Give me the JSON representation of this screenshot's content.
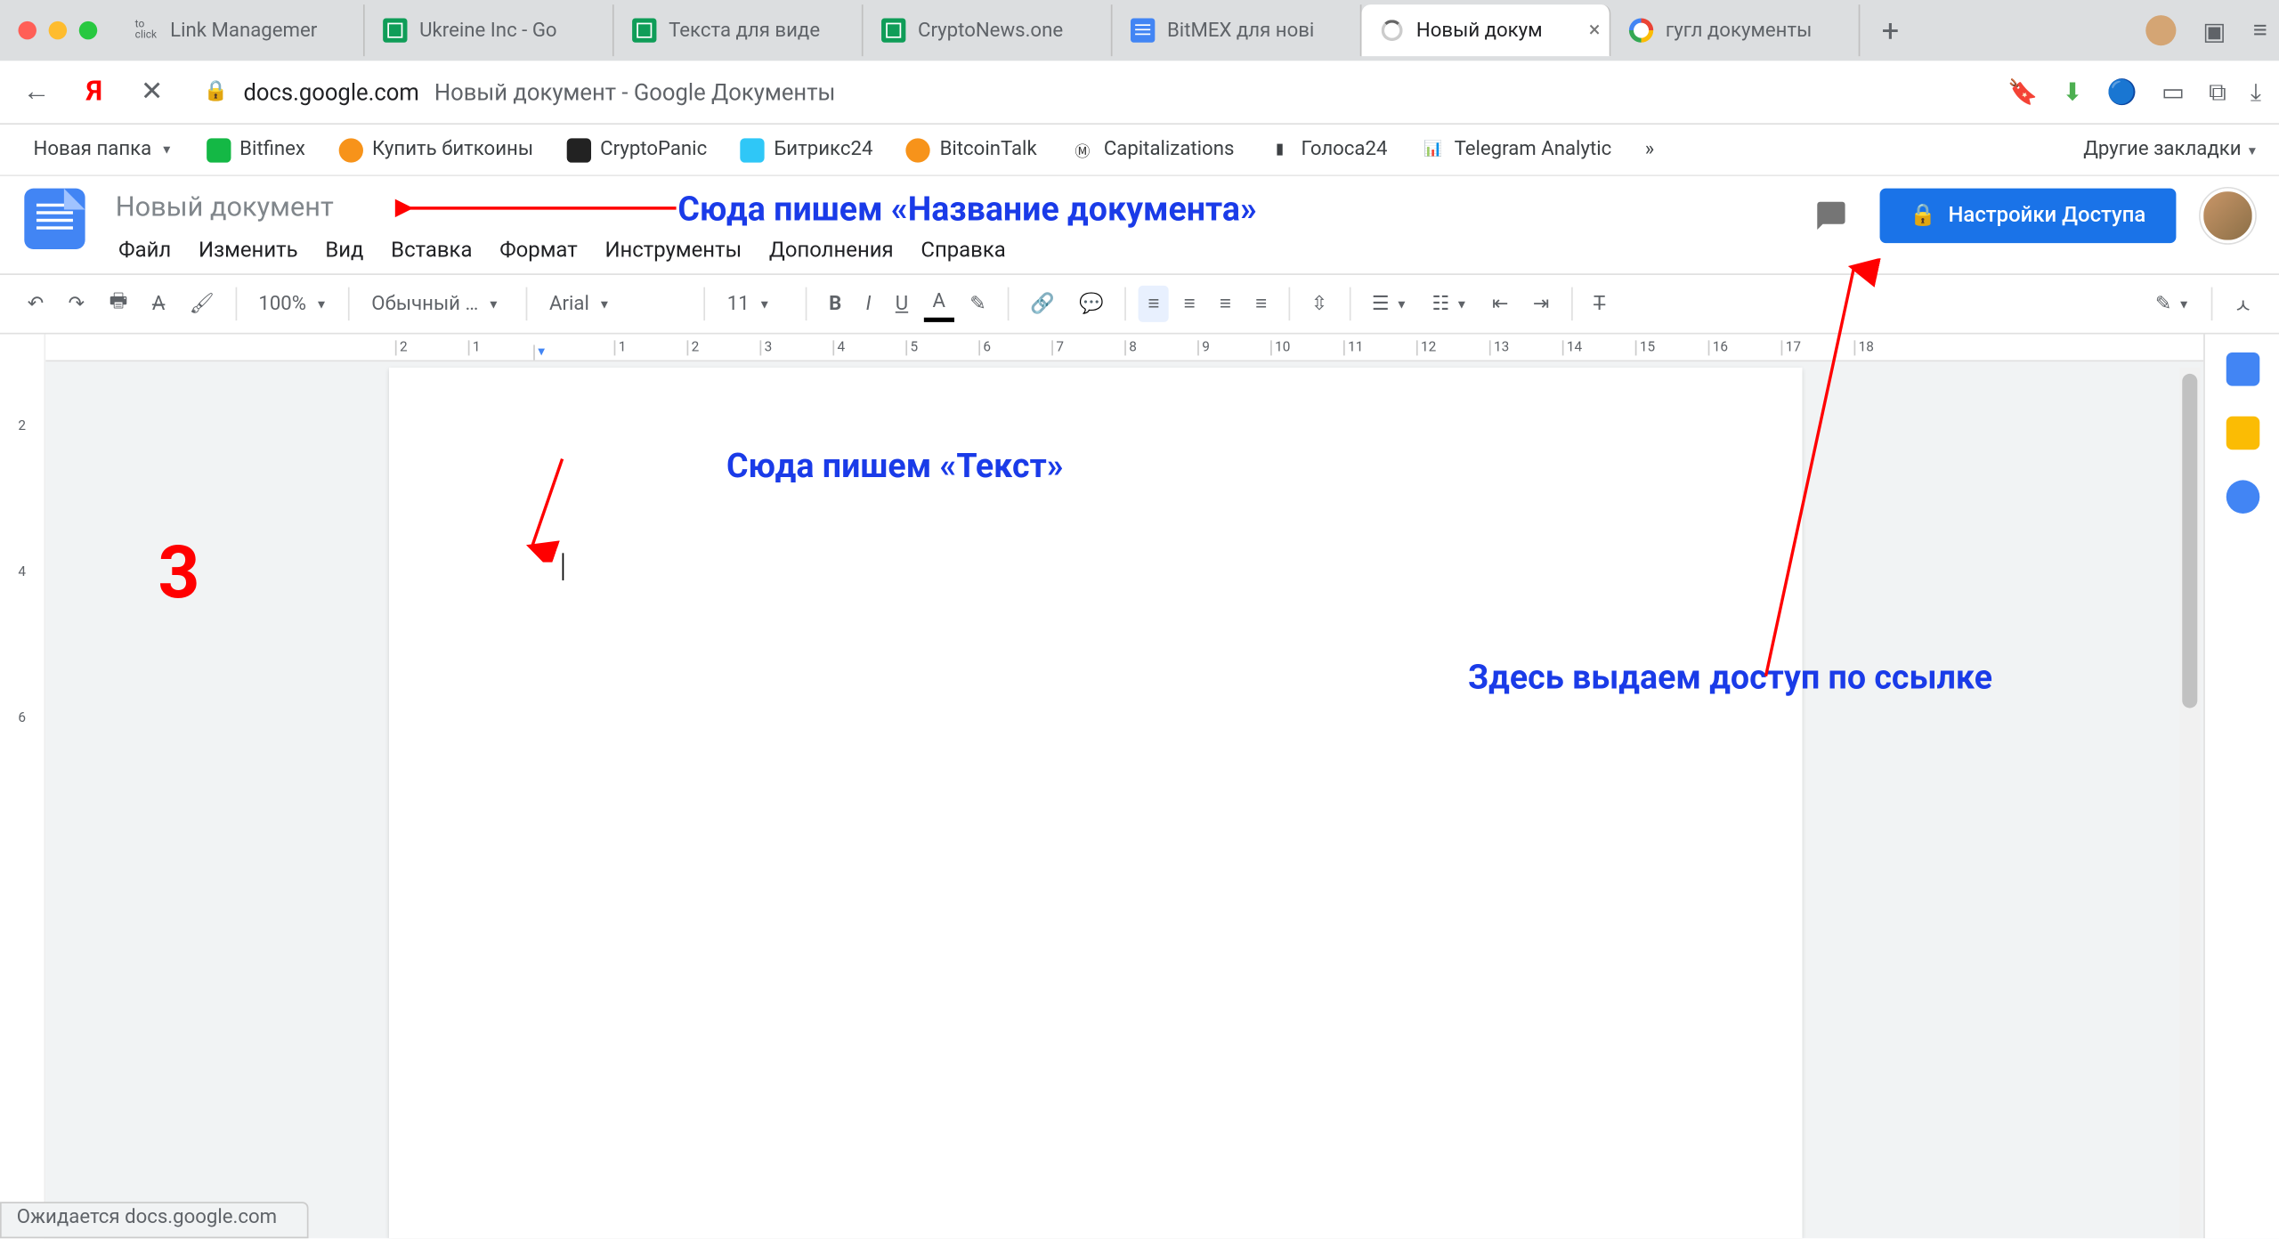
{
  "browser": {
    "tabs": [
      {
        "label": "Link Managemer",
        "favicon": "toclick"
      },
      {
        "label": "Ukreine Inc - Go",
        "favicon": "sheets"
      },
      {
        "label": "Текста для виде",
        "favicon": "sheets"
      },
      {
        "label": "CryptoNews.one",
        "favicon": "sheets"
      },
      {
        "label": "BitMEX для нові",
        "favicon": "docs"
      },
      {
        "label": "Новый докум",
        "favicon": "spinner",
        "active": true,
        "closable": true
      },
      {
        "label": "гугл документы",
        "favicon": "google"
      }
    ],
    "address": {
      "domain": "docs.google.com",
      "title": "Новый документ - Google Документы"
    }
  },
  "bookmarks": [
    {
      "label": "Новая папка",
      "dd": true
    },
    {
      "label": "Bitfinex",
      "color": "#14b845"
    },
    {
      "label": "Купить биткоины",
      "color": "#f7931a"
    },
    {
      "label": "CryptoPanic",
      "color": "#222"
    },
    {
      "label": "Битрикс24",
      "color": "#2fc7f7"
    },
    {
      "label": "BitcoinTalk",
      "color": "#f7931a"
    },
    {
      "label": "Capitalizations",
      "color": "#333"
    },
    {
      "label": "Голоса24",
      "color": "#8a6d3b"
    },
    {
      "label": "Telegram Analytic",
      "color": "#333"
    }
  ],
  "bookmarks_more": "»",
  "other_bookmarks": "Другие закладки",
  "docs": {
    "title": "Новый документ",
    "menus": [
      "Файл",
      "Изменить",
      "Вид",
      "Вставка",
      "Формат",
      "Инструменты",
      "Дополнения",
      "Справка"
    ],
    "share": "Настройки Доступа"
  },
  "toolbar": {
    "zoom": "100%",
    "style": "Обычный …",
    "font": "Arial",
    "size": "11"
  },
  "ruler_h": [
    "2",
    "1",
    "",
    "1",
    "2",
    "3",
    "4",
    "5",
    "6",
    "7",
    "8",
    "9",
    "10",
    "11",
    "12",
    "13",
    "14",
    "15",
    "16",
    "17",
    "18"
  ],
  "ruler_v": [
    "",
    "2",
    "",
    "4",
    "",
    "6",
    ""
  ],
  "annotations": {
    "title_hint": "Сюда пишем «Название документа»",
    "text_hint": "Сюда пишем «Текст»",
    "share_hint": "Здесь выдаем доступ по ссылке",
    "step": "3"
  },
  "status": "Ожидается docs.google.com"
}
